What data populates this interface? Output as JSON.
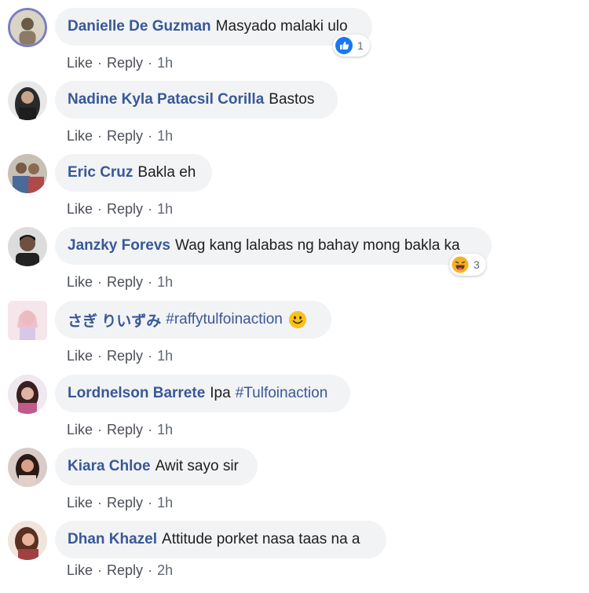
{
  "comments": [
    {
      "author": "Danielle De Guzman",
      "text": "Masyado malaki ulo",
      "actions": {
        "like": "Like",
        "reply": "Reply",
        "time": "1h"
      },
      "reaction": {
        "type": "like",
        "count": "1"
      }
    },
    {
      "author": "Nadine Kyla Patacsil Corilla",
      "text": "Bastos",
      "actions": {
        "like": "Like",
        "reply": "Reply",
        "time": "1h"
      }
    },
    {
      "author": "Eric Cruz",
      "text": "Bakla eh",
      "actions": {
        "like": "Like",
        "reply": "Reply",
        "time": "1h"
      }
    },
    {
      "author": "Janzky Forevs",
      "text": "Wag kang lalabas ng bahay mong bakla ka",
      "actions": {
        "like": "Like",
        "reply": "Reply",
        "time": "1h"
      },
      "reaction": {
        "type": "haha",
        "count": "3"
      }
    },
    {
      "author": "さぎ りいずみ",
      "text": "#raffytulfoinaction",
      "actions": {
        "like": "Like",
        "reply": "Reply",
        "time": "1h"
      },
      "emoji": "smiling-face"
    },
    {
      "author": "Lordnelson Barrete",
      "text": "Ipa",
      "hashtag": "#Tulfoinaction",
      "actions": {
        "like": "Like",
        "reply": "Reply",
        "time": "1h"
      }
    },
    {
      "author": "Kiara Chloe",
      "text": "Awit sayo sir",
      "actions": {
        "like": "Like",
        "reply": "Reply",
        "time": "1h"
      }
    },
    {
      "author": "Dhan Khazel",
      "text": "Attitude porket nasa taas na a",
      "actions": {
        "like": "Like",
        "reply": "Reply",
        "time": "2h"
      }
    }
  ],
  "colors": {
    "author": "#385898",
    "bubble": "#f2f3f5",
    "meta": "#606770",
    "like_blue": "#1877f2",
    "haha_yellow": "#f7b125"
  }
}
